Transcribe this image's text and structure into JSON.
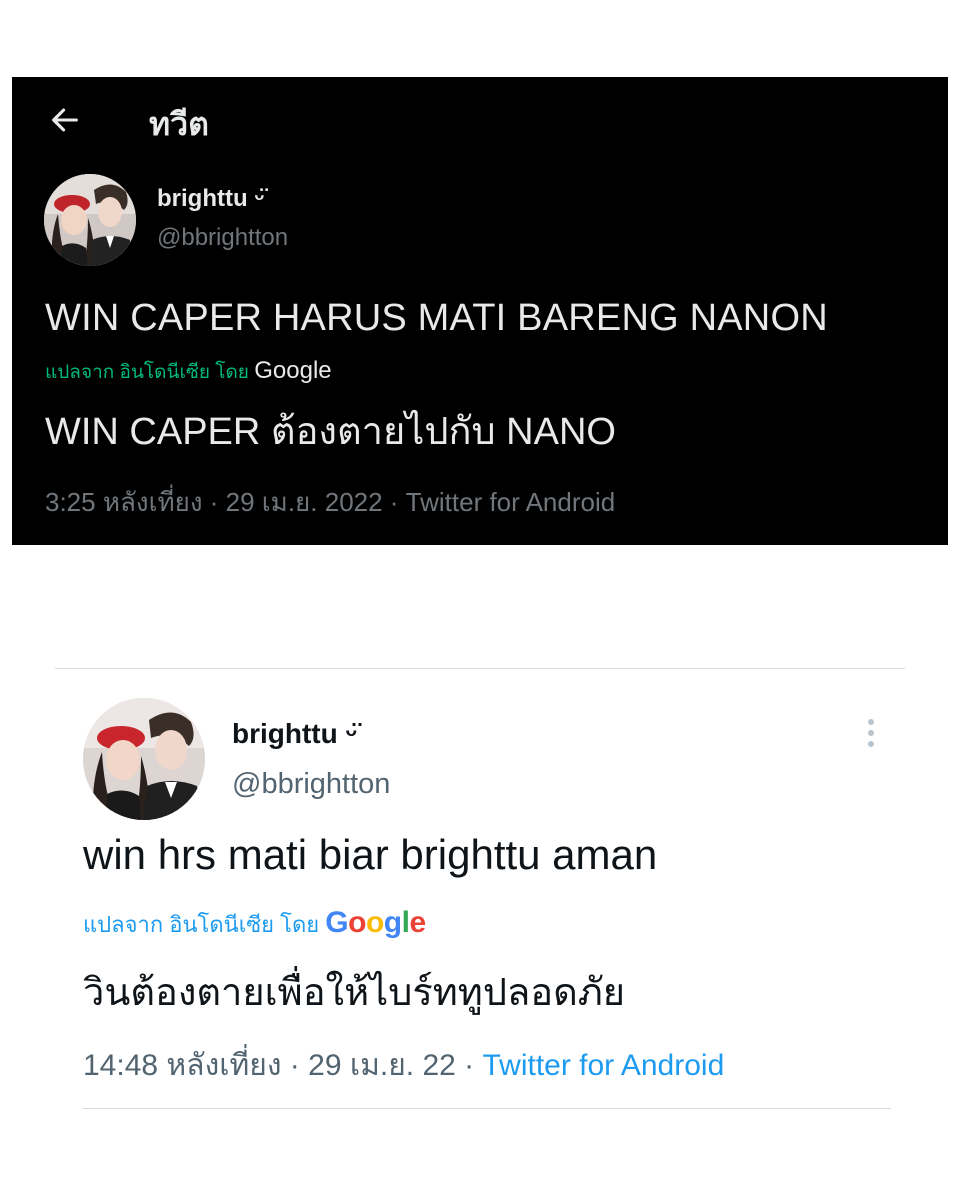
{
  "colors": {
    "dark_bg": "#000000",
    "dark_text": "#e7e9ea",
    "dark_secondary": "#71767b",
    "dark_translate_accent": "#00ba7c",
    "light_text": "#0f1419",
    "light_secondary": "#536471",
    "link_blue": "#1d9bf0"
  },
  "dark_tweet": {
    "header": {
      "back_icon": "back-arrow-icon",
      "title": "ทวีต"
    },
    "author": {
      "name": "brighttu ",
      "name_emoji": "ᵕ̈",
      "handle": "@bbrightton"
    },
    "text": "WIN CAPER HARUS MATI BARENG NANON",
    "translate_label": "แปลจาก อินโดนีเซีย โดย ",
    "translate_provider": "Google",
    "translation": "WIN CAPER ต้องตายไปกับ NANO",
    "meta": "3:25 หลังเที่ยง · 29 เม.ย. 2022 · Twitter for Android"
  },
  "light_tweet": {
    "author": {
      "name": "brighttu ",
      "name_emoji": "ᵕ̈",
      "handle": "@bbrightton"
    },
    "more_icon": "more-vertical-icon",
    "text": "win hrs mati biar brighttu aman",
    "translate_label": "แปลจาก อินโดนีเซีย โดย ",
    "translate_provider": {
      "G": "G",
      "o1": "o",
      "o2": "o",
      "g": "g",
      "l": "l",
      "e": "e"
    },
    "translation": "วินต้องตายเพื่อให้ไบร์ททูปลอดภัย",
    "meta_time": "14:48 หลังเที่ยง · 29 เม.ย. 22 · ",
    "meta_source": "Twitter for Android"
  }
}
